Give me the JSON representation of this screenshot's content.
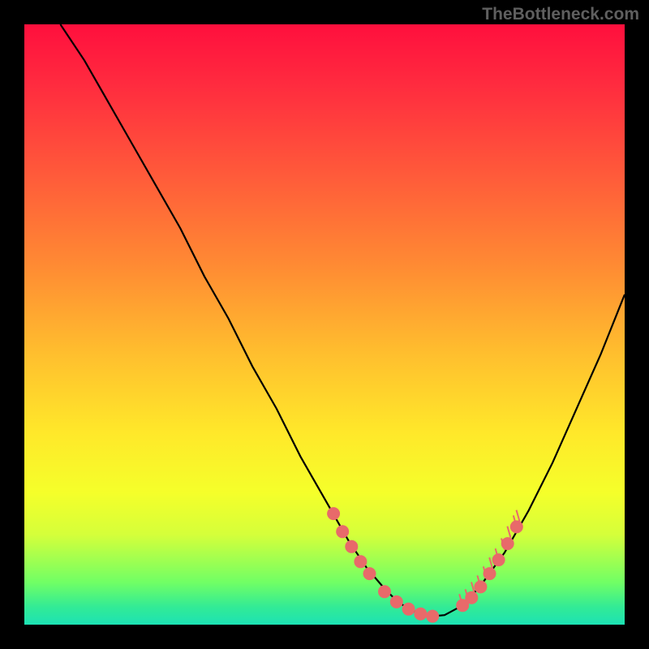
{
  "watermark": "TheBottleneck.com",
  "colors": {
    "curve": "#000000",
    "marker_fill": "#e86a6a",
    "marker_stroke": "#e86a6a",
    "tick": "#e86a6a",
    "background_top": "#ff0f3d",
    "background_bottom": "#1de2b4"
  },
  "chart_data": {
    "type": "line",
    "title": "",
    "xlabel": "",
    "ylabel": "",
    "xlim": [
      0,
      100
    ],
    "ylim": [
      0,
      100
    ],
    "series": [
      {
        "name": "curve",
        "x": [
          6,
          10,
          14,
          18,
          22,
          26,
          30,
          34,
          38,
          42,
          46,
          50,
          54,
          57,
          60,
          62,
          64,
          66,
          68,
          70,
          73,
          76,
          80,
          84,
          88,
          92,
          96,
          100
        ],
        "y": [
          100,
          94,
          87,
          80,
          73,
          66,
          58,
          51,
          43,
          36,
          28,
          21,
          14,
          9.5,
          6,
          4,
          2.6,
          1.8,
          1.4,
          1.6,
          3.2,
          6.5,
          12,
          19,
          27,
          36,
          45,
          55
        ]
      }
    ],
    "markers_left": {
      "x": [
        51.5,
        53.0,
        54.5,
        56.0,
        57.5,
        60.0,
        62.0,
        64.0,
        66.0,
        68.0
      ],
      "y": [
        18.5,
        15.5,
        13.0,
        10.5,
        8.5,
        5.5,
        3.8,
        2.6,
        1.8,
        1.4
      ]
    },
    "markers_right": {
      "x": [
        73.0,
        74.5,
        76.0,
        77.5,
        79.0,
        80.5,
        82.0
      ],
      "y": [
        3.2,
        4.5,
        6.3,
        8.5,
        10.8,
        13.5,
        16.3
      ]
    },
    "ticks_right": {
      "x": [
        73.0,
        74.0,
        75.0,
        76.0,
        77.0,
        78.0,
        79.0,
        80.0,
        81.0,
        82.0,
        82.5
      ],
      "y": [
        3.2,
        4.0,
        5.2,
        6.3,
        7.8,
        9.3,
        10.8,
        12.5,
        14.5,
        16.3,
        17.2
      ]
    }
  }
}
